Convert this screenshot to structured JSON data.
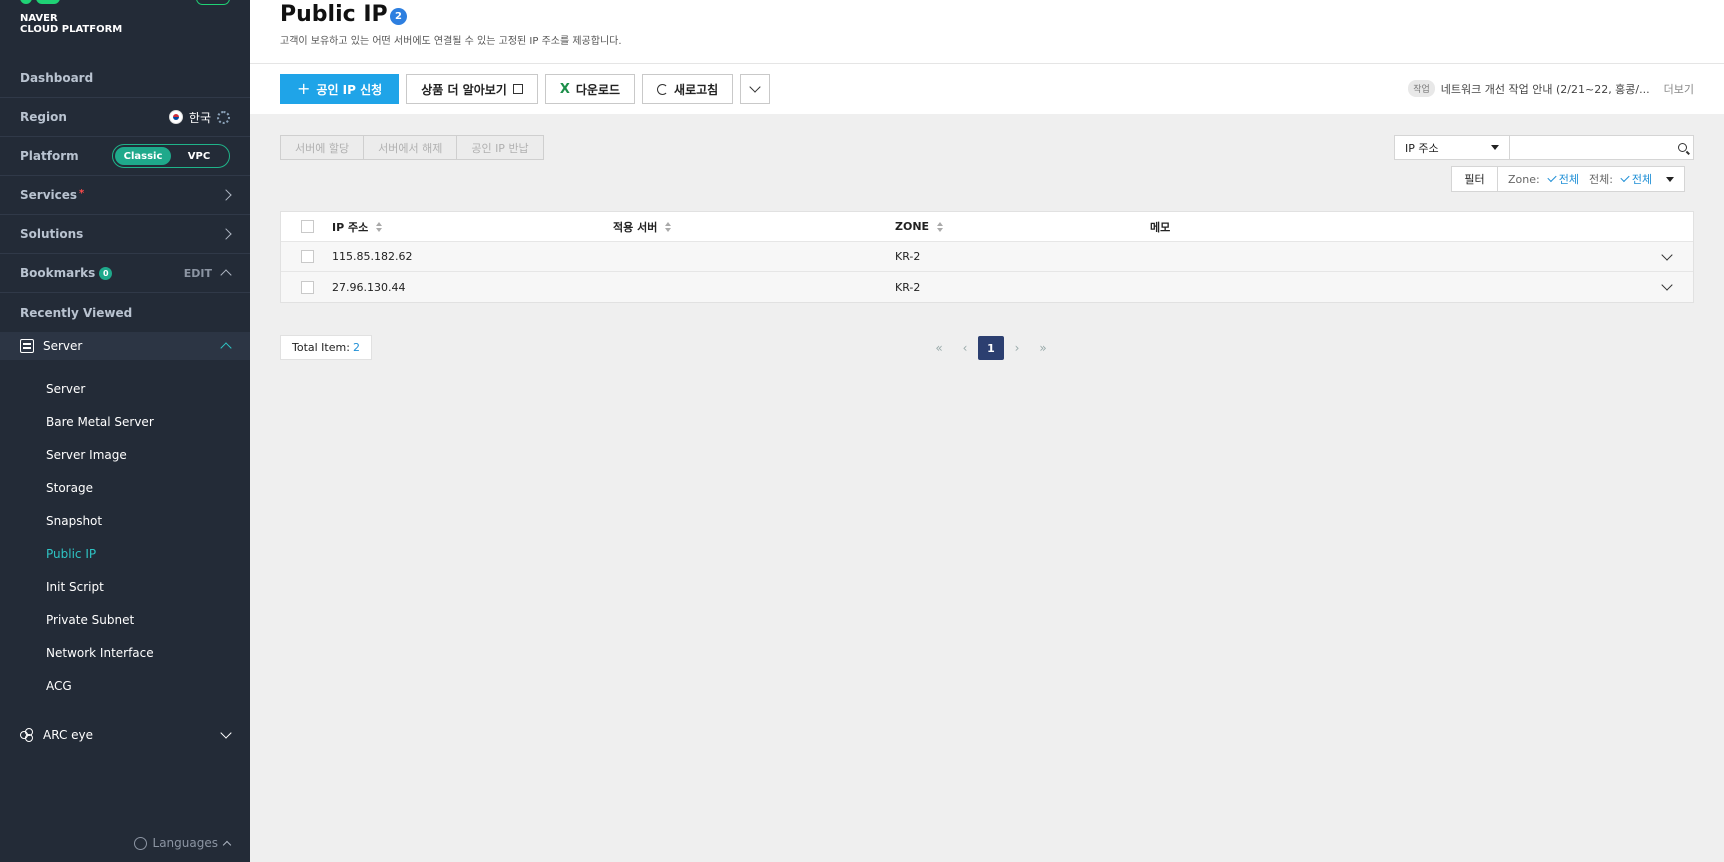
{
  "brand": {
    "line1": "NAVER",
    "line2": "CLOUD PLATFORM"
  },
  "sidebar": {
    "dashboard": "Dashboard",
    "region": {
      "label": "Region",
      "value": "한국"
    },
    "platform": {
      "label": "Platform",
      "options": [
        "Classic",
        "VPC"
      ],
      "selected": "Classic"
    },
    "services": "Services",
    "services_marker": "*",
    "solutions": "Solutions",
    "bookmarks": {
      "label": "Bookmarks",
      "count": "0",
      "edit": "EDIT"
    },
    "recently_viewed": "Recently Viewed",
    "server_group": "Server",
    "server_items": [
      "Server",
      "Bare Metal Server",
      "Server Image",
      "Storage",
      "Snapshot",
      "Public IP",
      "Init Script",
      "Private Subnet",
      "Network Interface",
      "ACG"
    ],
    "active_item": "Public IP",
    "arc_eye": "ARC eye",
    "languages": "Languages"
  },
  "header": {
    "title": "Public IP",
    "count": "2",
    "description": "고객이 보유하고 있는 어떤 서버에도 연결될 수 있는 고정된 IP 주소를 제공합니다."
  },
  "toolbar": {
    "apply": "공인 IP 신청",
    "learn_more": "상품 더 알아보기",
    "download": "다운로드",
    "refresh": "새로고침"
  },
  "notice": {
    "tag": "작업",
    "text": "네트워크 개선 작업 안내 (2/21~22, 홍콩/...",
    "more": "더보기"
  },
  "actions": [
    "서버에 할당",
    "서버에서 해제",
    "공인 IP 반납"
  ],
  "search": {
    "field": "IP 주소",
    "placeholder": ""
  },
  "filter": {
    "button": "필터",
    "zone_label": "Zone:",
    "zone_value": "전체",
    "all_label": "전체:",
    "all_value": "전체"
  },
  "table": {
    "columns": [
      "IP 주소",
      "적용 서버",
      "ZONE",
      "메모"
    ],
    "rows": [
      {
        "ip": "115.85.182.62",
        "server": "",
        "zone": "KR-2",
        "memo": ""
      },
      {
        "ip": "27.96.130.44",
        "server": "",
        "zone": "KR-2",
        "memo": ""
      }
    ]
  },
  "footer": {
    "total_label": "Total Item:",
    "total_value": "2",
    "current_page": "1"
  },
  "colors": {
    "sidebar_bg": "#232b37",
    "primary": "#1fa4e8",
    "accent": "#2ec4c4",
    "brand_green": "#1fd275",
    "pager_active": "#2c3f70"
  }
}
